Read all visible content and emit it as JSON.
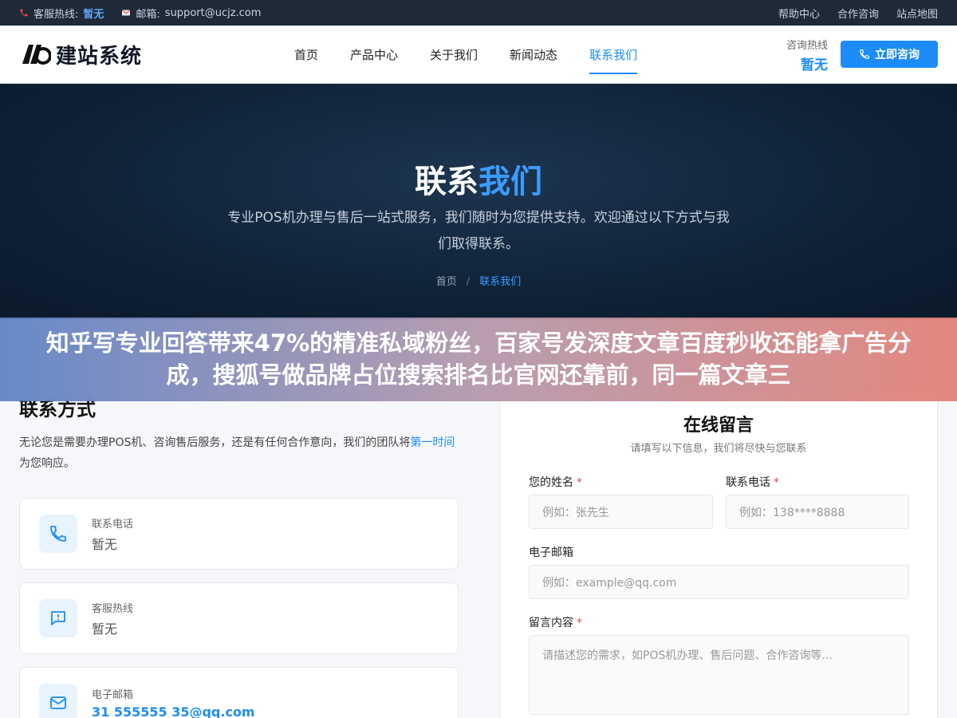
{
  "topbar": {
    "hotline_label": "客服热线:",
    "hotline_value": "暂无",
    "email_label": "邮箱:",
    "email_value": "support@ucjz.com",
    "links": [
      "帮助中心",
      "合作咨询",
      "站点地图"
    ]
  },
  "header": {
    "logo_text": "建站系统",
    "nav": [
      "首页",
      "产品中心",
      "关于我们",
      "新闻动态",
      "联系我们"
    ],
    "hotline_label": "咨询热线",
    "hotline_value": "暂无",
    "consult_button": "立即咨询"
  },
  "hero": {
    "title_part1": "联系",
    "title_part2": "我们",
    "description": "专业POS机办理与售后一站式服务，我们随时为您提供支持。欢迎通过以下方式与我们取得联系。",
    "breadcrumb_home": "首页",
    "breadcrumb_sep": "/",
    "breadcrumb_current": "联系我们"
  },
  "banner": {
    "text": "知乎写专业回答带来47%的精准私域粉丝，百家号发深度文章百度秒收还能拿广告分成，搜狐号做品牌占位搜索排名比官网还靠前，同一篇文章三"
  },
  "contact": {
    "title": "联系方式",
    "intro_text": "无论您是需要办理POS机、咨询售后服务，还是有任何合作意向，我们的团队将",
    "intro_highlight": "第一时间",
    "intro_end": "为您响应。",
    "cards": [
      {
        "label": "联系电话",
        "value": "暂无",
        "icon": "phone-icon"
      },
      {
        "label": "客服热线",
        "value": "暂无",
        "icon": "message-icon"
      },
      {
        "label": "电子邮箱",
        "value": "31 555555 35@qq.com",
        "icon": "mail-icon"
      }
    ]
  },
  "form": {
    "title": "在线留言",
    "subtitle": "请填写以下信息，我们将尽快与您联系",
    "name_label": "您的姓名",
    "name_placeholder": "例如：张先生",
    "phone_label": "联系电话",
    "phone_placeholder": "例如：138****8888",
    "email_label": "电子邮箱",
    "email_placeholder": "例如：example@qq.com",
    "message_label": "留言内容",
    "message_placeholder": "请描述您的需求，如POS机办理、售后问题、合作咨询等...",
    "required_mark": "*"
  },
  "colors": {
    "accent": "#1d8cf8",
    "topbar": "#1f2937",
    "hero": "#0f2236"
  }
}
